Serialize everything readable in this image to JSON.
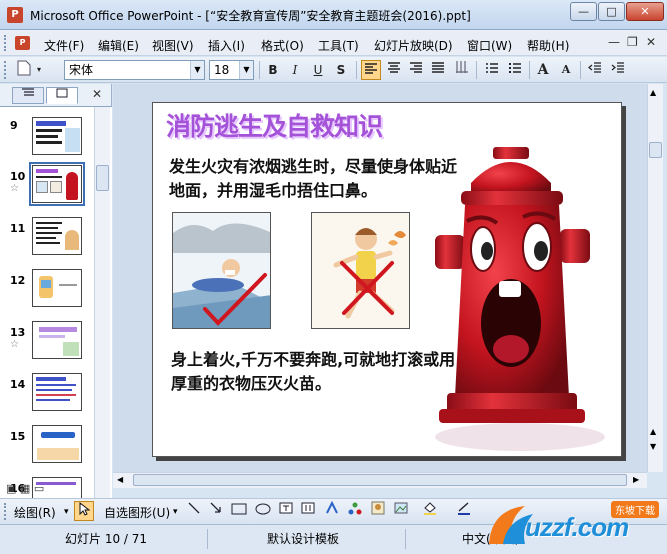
{
  "window": {
    "title": "Microsoft Office PowerPoint - [“安全教育宣传周”安全教育主题班会(2016).ppt]",
    "app_icon": "powerpoint-icon",
    "minimize": "—",
    "maximize": "□",
    "close": "✕"
  },
  "menu": {
    "items": [
      "文件(F)",
      "编辑(E)",
      "视图(V)",
      "插入(I)",
      "格式(O)",
      "工具(T)",
      "幻灯片放映(D)",
      "窗口(W)",
      "帮助(H)"
    ],
    "doc_minimize": "—",
    "doc_restore": "❐",
    "doc_close": "✕"
  },
  "format_toolbar": {
    "font_name": "宋体",
    "font_size": "18",
    "bold": "B",
    "italic": "I",
    "underline": "U",
    "shadow": "S",
    "increase_font": "A",
    "decrease_font": "A"
  },
  "slides_panel": {
    "tab_outline_icon": "outline-icon",
    "tab_slides_icon": "slides-icon",
    "close": "✕",
    "thumbnails": [
      {
        "num": "9",
        "star": ""
      },
      {
        "num": "10",
        "star": "☆"
      },
      {
        "num": "11",
        "star": ""
      },
      {
        "num": "12",
        "star": ""
      },
      {
        "num": "13",
        "star": "☆"
      },
      {
        "num": "14",
        "star": ""
      },
      {
        "num": "15",
        "star": ""
      },
      {
        "num": "16",
        "star": ""
      }
    ]
  },
  "slide": {
    "title": "消防逃生及自救知识",
    "text1": "发生火灾有浓烟逃生时，尽量使身体贴近地面，并用湿毛巾捂住口鼻。",
    "text2": "身上着火,千万不要奔跑,可就地打滚或用厚重的衣物压灭火苗。"
  },
  "drawing_toolbar": {
    "draw": "绘图(R)",
    "autoshapes": "自选图形(U)"
  },
  "status": {
    "slide_position": "幻灯片 10 / 71",
    "template": "默认设计模板",
    "language": "中文(中国)"
  },
  "watermark": {
    "brand": "uzzf.com",
    "tagline": "东坡下载"
  },
  "colors": {
    "title_purple": "#a453d8",
    "hydrant_red": "#c4141f",
    "check_red": "#d0161e",
    "watermark_orange": "#f27a1a"
  }
}
